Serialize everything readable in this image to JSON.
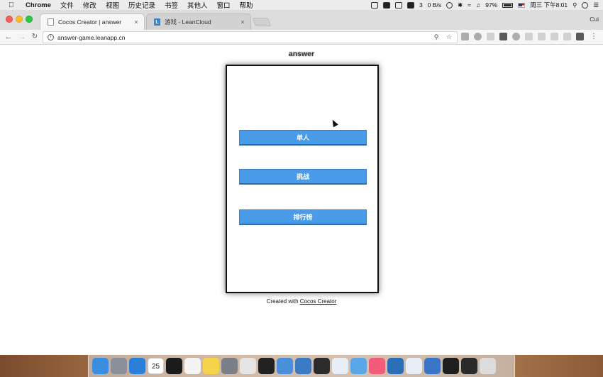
{
  "menubar": {
    "app_name": "Chrome",
    "items": [
      "文件",
      "修改",
      "视图",
      "历史记录",
      "书签",
      "其他人",
      "窗口",
      "帮助"
    ],
    "status_number": "3",
    "net_speed": "0 B/s",
    "battery_percent": "97%",
    "clock": "周三 下午8:01"
  },
  "browser": {
    "tabs": [
      {
        "title": "Cocos Creator | answer",
        "close": "×"
      },
      {
        "title": "游戏 - LeanCloud",
        "close": "×",
        "favicon_letter": "L"
      }
    ],
    "profile": "Cui",
    "url": "answer-game.leanapp.cn"
  },
  "page": {
    "title": "answer",
    "buttons": [
      "单人",
      "挑战",
      "排行榜"
    ],
    "footer_prefix": "Created with ",
    "footer_link": "Cocos Creator"
  },
  "colors": {
    "button_blue": "#4a9ce8",
    "page_bg": "#ffffff"
  },
  "dock": {
    "icons": [
      "finder-icon",
      "launchpad-icon",
      "safari-icon",
      "calendar-icon",
      "terminal-icon",
      "reminders-icon",
      "notes-icon",
      "system-preferences-icon",
      "chrome-icon",
      "qq-icon",
      "xcode-icon",
      "files-icon",
      "github-icon",
      "app-icon",
      "messages-icon",
      "music-icon",
      "vscode-icon",
      "app-icon-2",
      "keynote-icon",
      "obs-icon",
      "app-icon-3",
      "trash-icon"
    ],
    "calendar_day": "25"
  }
}
